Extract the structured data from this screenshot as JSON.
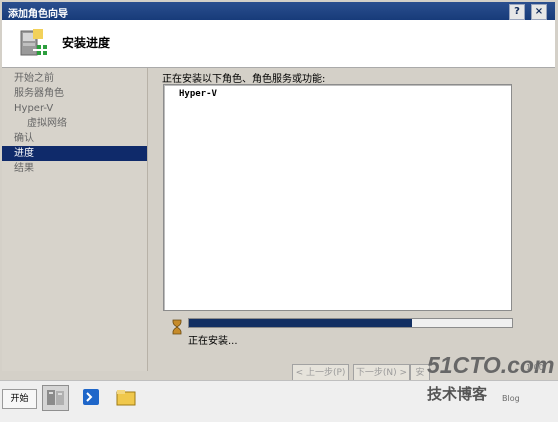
{
  "window": {
    "title": "添加角色向导",
    "header_title": "安装进度"
  },
  "nav": {
    "items": [
      {
        "label": "开始之前"
      },
      {
        "label": "服务器角色"
      },
      {
        "label": "Hyper-V"
      },
      {
        "label": "虚拟网络"
      },
      {
        "label": "确认"
      },
      {
        "label": "进度"
      },
      {
        "label": "结果"
      }
    ],
    "active": "进度"
  },
  "main": {
    "instruction": "正在安装以下角色、角色服务或功能:",
    "items": [
      "Hyper-V"
    ],
    "progress_fraction": 0.69,
    "status": "正在安装..."
  },
  "buttons": {
    "prev": "< 上一步(P)",
    "next": "下一步(N) >",
    "install_partial": "安"
  },
  "taskbar": {
    "start": "开始",
    "apps": [
      "server-manager-icon",
      "powershell-icon",
      "explorer-icon"
    ]
  },
  "watermark": {
    "main": "51CTO.com",
    "sub": "技术博客",
    "small": "Blog",
    "tiny": "1·00"
  },
  "colors": {
    "titlebar": "#1a3f7d",
    "active_nav": "#0f2a6a",
    "progress_fill": "#122f63"
  }
}
